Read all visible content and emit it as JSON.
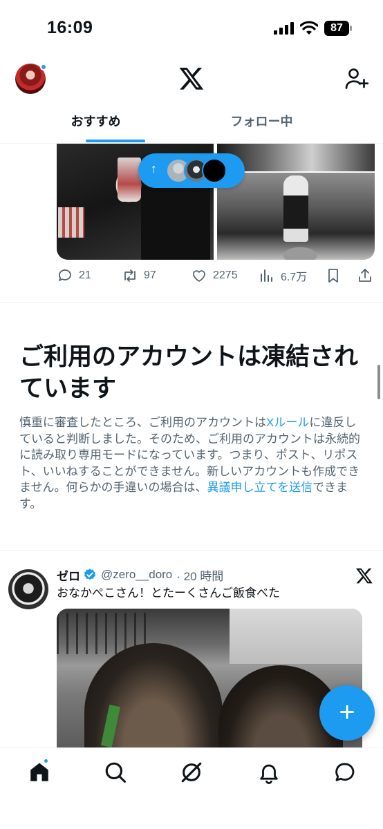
{
  "status_bar": {
    "time": "16:09",
    "battery": "87"
  },
  "header": {
    "logo": "x-logo-icon",
    "follow_icon": "person-add-icon"
  },
  "tabs": [
    {
      "label": "おすすめ",
      "active": true
    },
    {
      "label": "フォロー中",
      "active": false
    }
  ],
  "top_tweet": {
    "actions": {
      "replies": "21",
      "reposts": "97",
      "likes": "2275",
      "views": "6.7万"
    }
  },
  "notice": {
    "title": "ご利用のアカウントは凍結されています",
    "body_1": "慎重に審査したところ、ご利用のアカウントは",
    "link_rules": "Xルール",
    "body_2": "に違反していると判断しました。そのため、ご利用のアカウントは永続的に読み取り専用モードになっています。つまり、ポスト、リポスト、いいねすることができません。新しいアカウントも作成できません。何らかの手違いの場合は、",
    "link_appeal": "異議申し立てを送信",
    "body_3": "できます。"
  },
  "tweet": {
    "name": "ゼロ",
    "handle": "@zero__doro",
    "time": "· 20 時間",
    "text": "おなかぺこさん！とたーくさんご飯食べた"
  },
  "fab_label": "+",
  "colors": {
    "accent": "#1d9bf0",
    "text": "#0f1419",
    "secondary": "#536471"
  },
  "bottom_nav": [
    "home-icon",
    "search-icon",
    "grok-icon",
    "notifications-icon",
    "messages-icon"
  ]
}
